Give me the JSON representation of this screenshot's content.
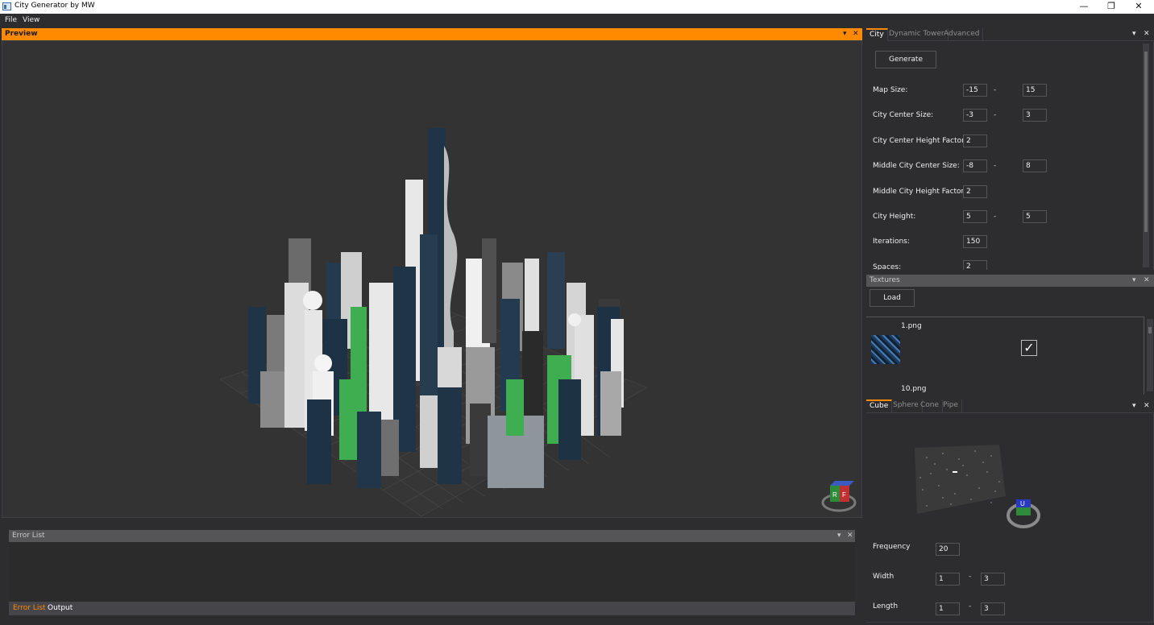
{
  "window": {
    "title": "City Generator by MW",
    "min_icon": "minimize-icon",
    "max_icon": "restore-icon",
    "close_icon": "close-icon"
  },
  "menu": {
    "items": [
      "File",
      "View"
    ]
  },
  "preview": {
    "title": "Preview",
    "pin": "📌",
    "close": "✕"
  },
  "error_list": {
    "title": "Error List",
    "tabs": [
      "Error List",
      "Output"
    ],
    "active_tab": "Error List"
  },
  "city_tabs": {
    "tabs": [
      "City",
      "Dynamic Tower",
      "Advanced"
    ],
    "active": "City"
  },
  "city": {
    "generate_label": "Generate",
    "map_size": {
      "label": "Map Size:",
      "min": "-15",
      "max": "15"
    },
    "city_center_size": {
      "label": "City Center Size:",
      "min": "-3",
      "max": "3"
    },
    "city_center_height_factor": {
      "label": "City Center Height Factor:",
      "value": "2"
    },
    "middle_city_center_size": {
      "label": "Middle City Center Size:",
      "min": "-8",
      "max": "8"
    },
    "middle_city_height_factor": {
      "label": "Middle City Height Factor:",
      "value": "2"
    },
    "city_height": {
      "label": "City Height:",
      "min": "5",
      "max": "5"
    },
    "iterations": {
      "label": "Iterations:",
      "value": "150"
    },
    "spaces": {
      "label": "Spaces:",
      "value": "2"
    },
    "range_dash": "-"
  },
  "textures": {
    "title": "Textures",
    "load_label": "Load",
    "items": [
      {
        "name": "1.png",
        "checked": true
      },
      {
        "name": "10.png",
        "checked": false
      }
    ]
  },
  "primitive_tabs": {
    "tabs": [
      "Cube",
      "Sphere",
      "Cone",
      "Pipe"
    ],
    "active": "Cube"
  },
  "primitive": {
    "frequency": {
      "label": "Frequency",
      "value": "20"
    },
    "width": {
      "label": "Width",
      "min": "1",
      "max": "3"
    },
    "length": {
      "label": "Length",
      "min": "1",
      "max": "3"
    },
    "range_dash": "-"
  },
  "colors": {
    "accent": "#ff8a00",
    "background": "#2d2d30",
    "viewport": "#333333",
    "header_gray": "#555558"
  }
}
